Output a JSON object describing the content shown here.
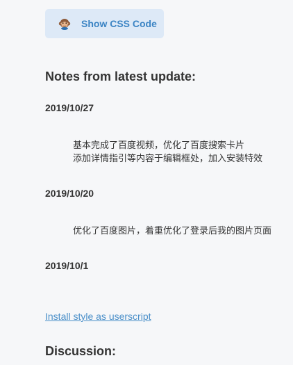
{
  "show_css_button": {
    "label": "Show CSS Code",
    "icon": "monkey-icon"
  },
  "notes": {
    "heading": "Notes from latest update:",
    "entries": [
      {
        "date": "2019/10/27",
        "lines": [
          "基本完成了百度视频，优化了百度搜索卡片",
          "添加详情指引等内容于编辑框处，加入安装特效"
        ]
      },
      {
        "date": "2019/10/20",
        "lines": [
          "优化了百度图片，着重优化了登录后我的图片页面"
        ]
      },
      {
        "date": "2019/10/1",
        "lines": []
      }
    ]
  },
  "install_link": "Install style as userscript",
  "discussion_heading": "Discussion:",
  "colors": {
    "button_bg": "#dde9f7",
    "button_text": "#3b84c4",
    "link": "#4a8fc9",
    "page_bg": "#f6f7f9"
  }
}
